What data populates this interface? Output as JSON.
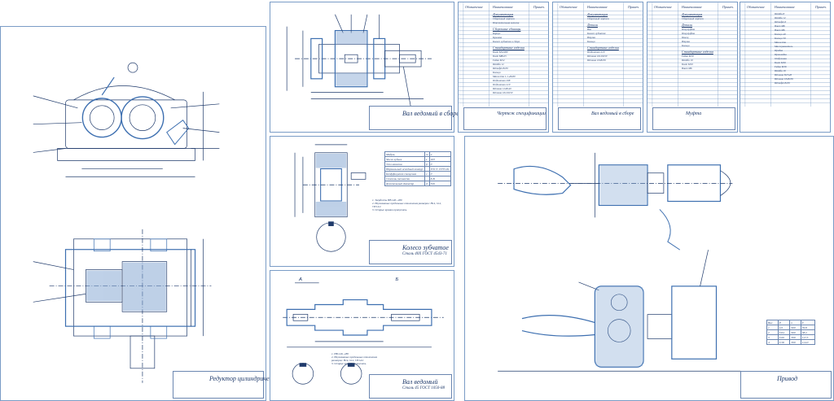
{
  "sheets": {
    "assembly": {
      "title": "Редуктор цилиндрический горизонтальный"
    },
    "shaft_assembly": {
      "title": "Вал ведомый в сборе"
    },
    "gear": {
      "title": "Колесо зубчатое",
      "material": "Сталь 40Х ГОСТ 4543-71"
    },
    "shaft": {
      "title": "Вал ведомый",
      "material": "Сталь 45 ГОСТ 1050-88"
    },
    "drive": {
      "title": "Привод"
    }
  },
  "spec_sheets": [
    {
      "title": "Чертеж спецификации",
      "head": [
        "Обозначение",
        "Наименование",
        "Примеч."
      ],
      "sections": [
        {
          "name": "Документация",
          "rows": [
            "Сборочный чертеж",
            "Пояснительная записка"
          ]
        },
        {
          "name": "Сборочные единицы",
          "rows": [
            "Корпус",
            "Крышка",
            "Колесо зубчатое в сборе"
          ]
        },
        {
          "name": "Стандартные изделия",
          "rows": [
            "Болт М12x80",
            "Болт М8x25",
            "Гайка М12",
            "Шайба 12",
            "Штифт 8x30",
            "Кольцо",
            "Манжета 1.1-40x60",
            "Подшипник 208",
            "Подшипник 210",
            "Шпонка 12x8x40",
            "Шпонка 16x10x50"
          ]
        }
      ]
    },
    {
      "title": "Вал ведомый в сборе",
      "head": [
        "Обозначение",
        "Наименование",
        "Примеч."
      ],
      "sections": [
        {
          "name": "Документация",
          "rows": [
            "Сборочный чертеж"
          ]
        },
        {
          "name": "Детали",
          "rows": [
            "Вал",
            "Колесо зубчатое",
            "Втулка",
            "Кольцо"
          ]
        },
        {
          "name": "Стандартные изделия",
          "rows": [
            "Подшипник 210",
            "Шпонка 16x10x50",
            "Шпонка 10x8x56"
          ]
        }
      ]
    },
    {
      "title": "Муфта",
      "head": [
        "Обозначение",
        "Наименование",
        "Примеч."
      ],
      "sections": [
        {
          "name": "Документация",
          "rows": [
            "Сборочный чертеж"
          ]
        },
        {
          "name": "Детали",
          "rows": [
            "Полумуфта",
            "Полумуфта",
            "Палец",
            "Втулка",
            "Кольцо"
          ]
        },
        {
          "name": "Стандартные изделия",
          "rows": [
            "Гайка М10",
            "Шайба 10",
            "Болт М10",
            "Винт М6"
          ]
        }
      ]
    },
    {
      "title": "",
      "head": [
        "Обозначение",
        "Наименование",
        "Примеч."
      ],
      "sections": [
        {
          "name": "",
          "rows": [
            "Шайба 8",
            "Шайба 12",
            "Штифт 6",
            "Винт М8",
            "Винт М6",
            "Кольцо 40",
            "Кольцо 50",
            "Манжета",
            "Маслоуказатель",
            "Пробка",
            "Прокладка",
            "Отдушина",
            "Болт М16",
            "Гайка М16",
            "Шайба 16",
            "Шпонка 8x7x40",
            "Шпонка 10x8x56",
            "Штифт 8x30"
          ]
        }
      ]
    }
  ],
  "gear_params": {
    "rows": [
      [
        "Модуль",
        "m",
        "2"
      ],
      [
        "Число зубьев",
        "z",
        "163"
      ],
      [
        "Угол наклона",
        "β",
        "0"
      ],
      [
        "Нормальный исходный контур",
        "",
        "ГОСТ 13755-81"
      ],
      [
        "Коэффициент смещения",
        "x",
        "0"
      ],
      [
        "Степень точности",
        "",
        "8-В"
      ],
      [
        "Делительный диаметр",
        "d",
        "326"
      ]
    ]
  },
  "gear_notes": [
    "1. Твердость HB 240...280",
    "2. Неуказанные предельные отклонения размеров: H14, h14, ±IT14/2",
    "3. Острые кромки притупить"
  ],
  "shaft_notes": [
    "1. HB 240...280",
    "2. Неуказанные предельные отклонения размеров: H14, h14, ±IT14/2",
    "3. Острые кромки притупить"
  ],
  "drive_table": {
    "rows": [
      [
        "Вал",
        "P",
        "n",
        "T"
      ],
      [
        "1",
        "4.0",
        "960",
        "39.8"
      ],
      [
        "2",
        "3.84",
        "960",
        "38.2"
      ],
      [
        "3",
        "3.69",
        "300",
        "117.5"
      ],
      [
        "4",
        "3.58",
        "300",
        "114.0"
      ]
    ]
  },
  "labels": {
    "section_a": "А",
    "section_b": "Б"
  },
  "colors": {
    "line": "#1f3a6b",
    "part": "#3d6fb0",
    "hatch": "#7fa3d1",
    "frame": "#7a9cc6"
  }
}
